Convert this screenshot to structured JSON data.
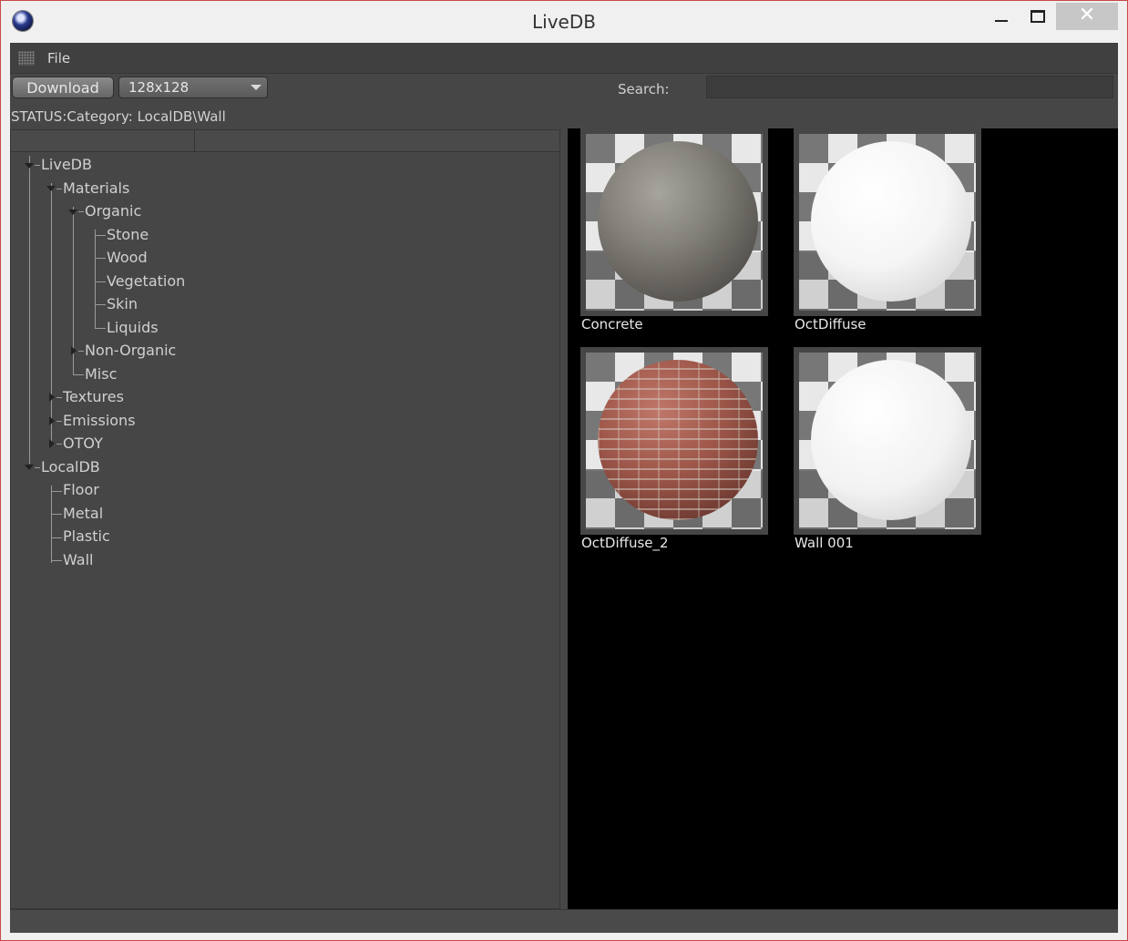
{
  "window": {
    "title": "LiveDB",
    "close_glyph": "✕"
  },
  "menu": {
    "file": "File"
  },
  "toolbar": {
    "download": "Download",
    "size_value": "128x128",
    "search_label": "Search:",
    "search_value": ""
  },
  "status": "STATUS:Category: LocalDB\\Wall",
  "tree": {
    "livedb": "LiveDB",
    "materials": "Materials",
    "organic": "Organic",
    "stone": "Stone",
    "wood": "Wood",
    "vegetation": "Vegetation",
    "skin": "Skin",
    "liquids": "Liquids",
    "non_organic": "Non-Organic",
    "misc": "Misc",
    "textures": "Textures",
    "emissions": "Emissions",
    "otoy": "OTOY",
    "localdb": "LocalDB",
    "floor": "Floor",
    "metal": "Metal",
    "plastic": "Plastic",
    "wall": "Wall"
  },
  "materials": [
    {
      "name": "Concrete",
      "preview": "concrete-sphere"
    },
    {
      "name": "OctDiffuse",
      "preview": "white-diffuse-sphere"
    },
    {
      "name": "OctDiffuse_2",
      "preview": "brick-sphere"
    },
    {
      "name": "Wall 001",
      "preview": "white-textured-sphere"
    }
  ],
  "colors": {
    "panel": "#464646",
    "viewer": "#000000",
    "text": "#d0d0d0",
    "window_border": "#c9464a"
  }
}
